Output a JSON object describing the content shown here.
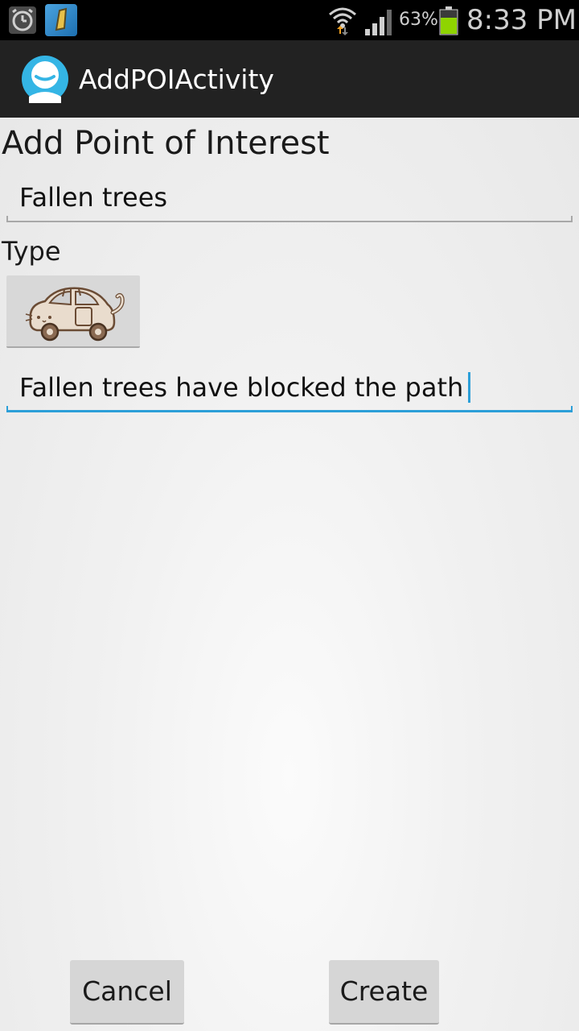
{
  "status_bar": {
    "battery_percent": "63%",
    "clock": "8:33 PM",
    "icons": [
      "alarm-icon",
      "note-app-icon",
      "wifi-icon",
      "signal-icon",
      "battery-icon"
    ],
    "battery_color": "#8fd400"
  },
  "action_bar": {
    "title": "AddPOIActivity",
    "icon": "app-avatar-icon",
    "accent": "#34b5e5"
  },
  "form": {
    "heading": "Add Point of Interest",
    "name_value": "Fallen trees",
    "type_label": "Type",
    "type_icon": "pusheen-car-icon",
    "description_value": "Fallen trees have blocked the path",
    "focus_color": "#2c9fd8"
  },
  "buttons": {
    "cancel": "Cancel",
    "create": "Create"
  }
}
